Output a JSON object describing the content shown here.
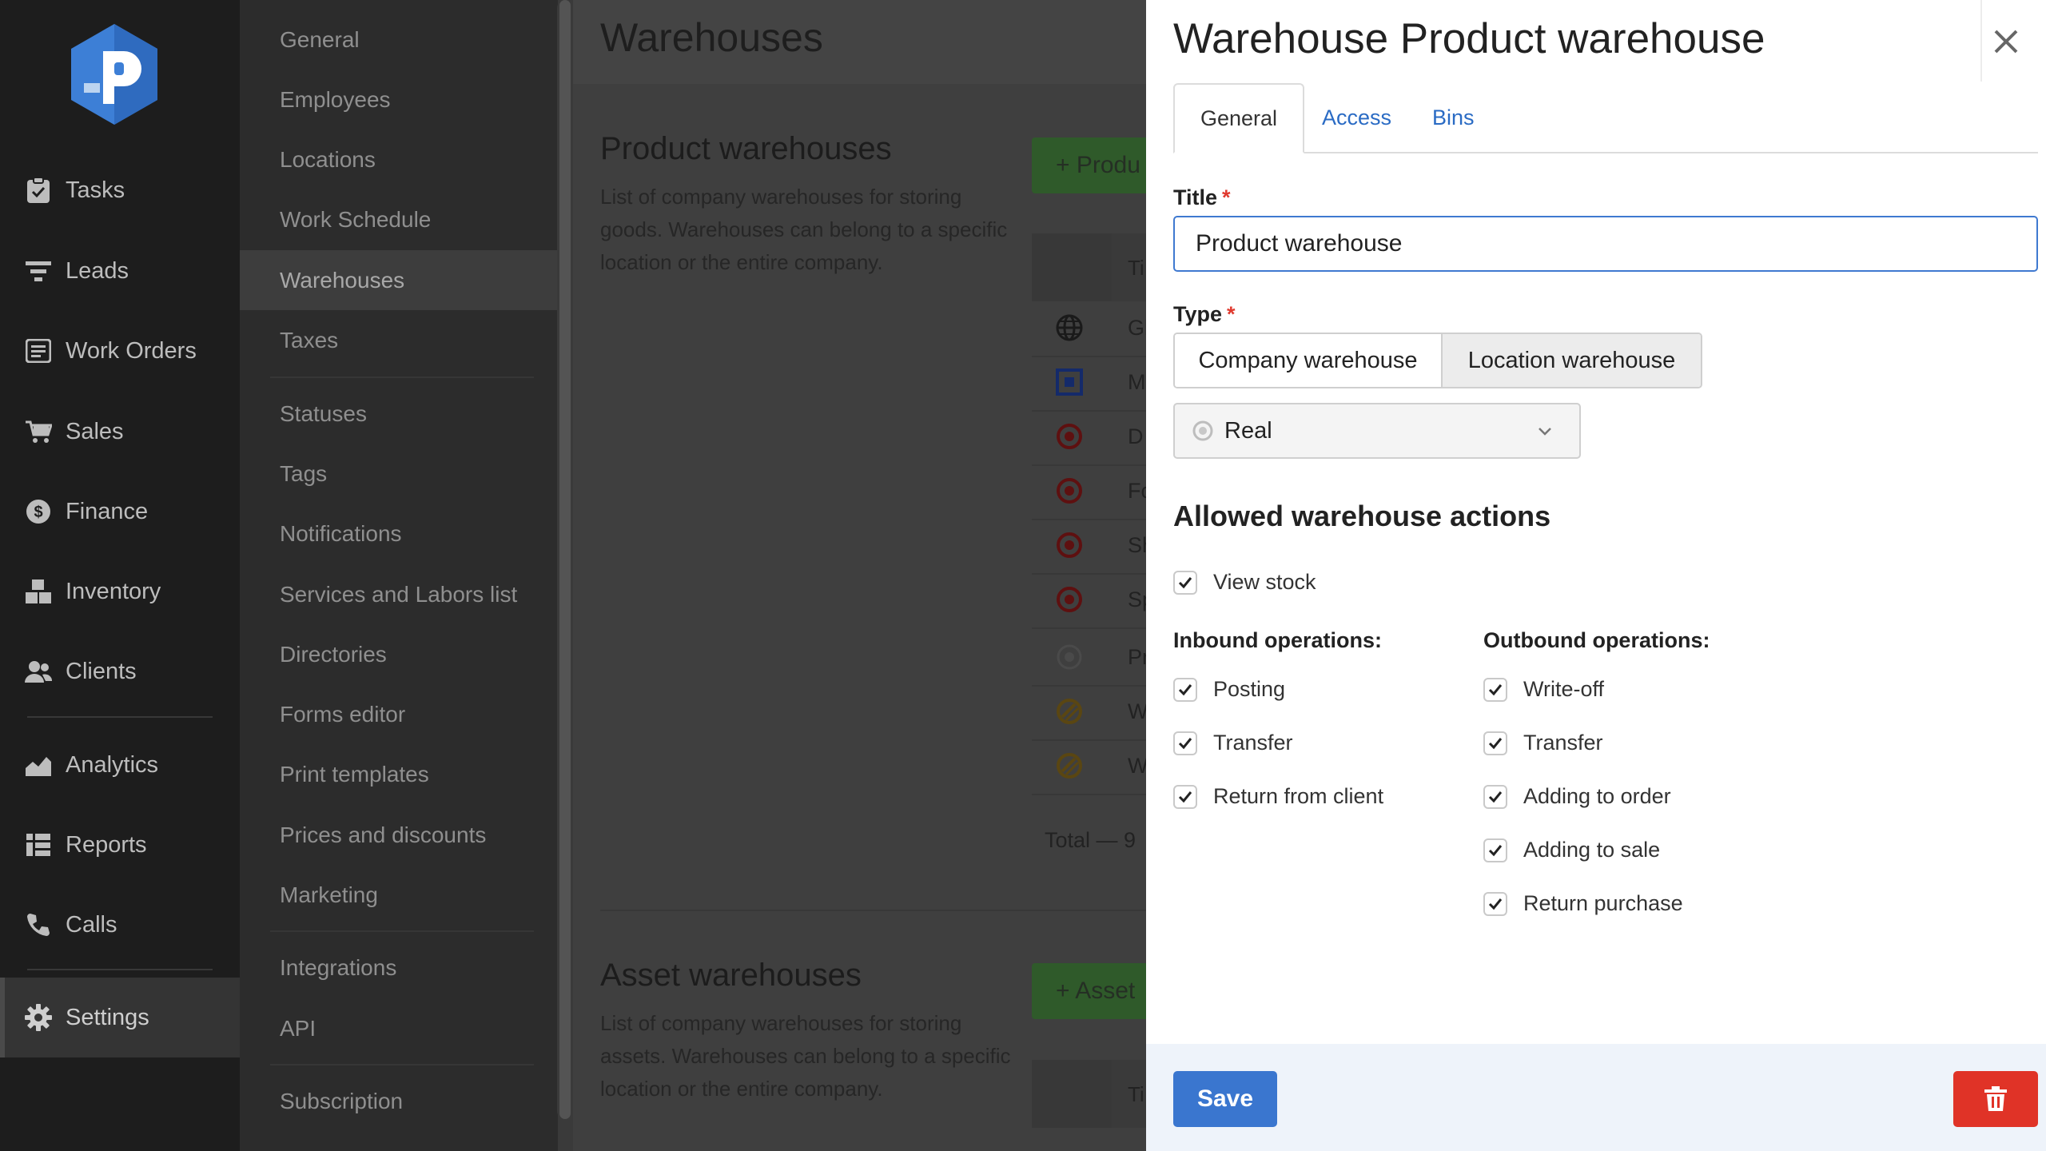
{
  "main_nav": {
    "items": [
      {
        "label": "Tasks",
        "icon": "clipboard-check-icon"
      },
      {
        "label": "Leads",
        "icon": "filter-icon"
      },
      {
        "label": "Work Orders",
        "icon": "work-order-icon"
      },
      {
        "label": "Sales",
        "icon": "cart-icon"
      },
      {
        "label": "Finance",
        "icon": "dollar-icon"
      },
      {
        "label": "Inventory",
        "icon": "boxes-icon"
      },
      {
        "label": "Clients",
        "icon": "users-icon"
      },
      {
        "label": "Analytics",
        "icon": "chart-area-icon"
      },
      {
        "label": "Reports",
        "icon": "reports-icon"
      },
      {
        "label": "Calls",
        "icon": "phone-icon"
      },
      {
        "label": "Settings",
        "icon": "gear-icon",
        "active": true
      }
    ]
  },
  "settings_nav": {
    "items": [
      {
        "label": "General"
      },
      {
        "label": "Employees"
      },
      {
        "label": "Locations"
      },
      {
        "label": "Work Schedule"
      },
      {
        "label": "Warehouses",
        "active": true
      },
      {
        "label": "Taxes"
      },
      {
        "label": "Statuses"
      },
      {
        "label": "Tags"
      },
      {
        "label": "Notifications"
      },
      {
        "label": "Services and Labors list"
      },
      {
        "label": "Directories"
      },
      {
        "label": "Forms editor"
      },
      {
        "label": "Print templates"
      },
      {
        "label": "Prices and discounts"
      },
      {
        "label": "Marketing"
      },
      {
        "label": "Integrations"
      },
      {
        "label": "API"
      },
      {
        "label": "Subscription"
      }
    ]
  },
  "content": {
    "title": "Warehouses",
    "product_section": {
      "title": "Product warehouses",
      "description": "List of company warehouses for storing goods. Warehouses can belong to a specific location or the entire company.",
      "add_button": "+ Produ",
      "table_header": "Ti",
      "rows": [
        {
          "text": "Gl",
          "icon": "globe-icon",
          "color": "#1a1a1a"
        },
        {
          "text": "M",
          "icon": "square-icon",
          "color": "#142a6a"
        },
        {
          "text": "D",
          "icon": "target-icon",
          "color": "#5e1010"
        },
        {
          "text": "Fo",
          "icon": "target-icon",
          "color": "#5e1010"
        },
        {
          "text": "Sh",
          "icon": "target-icon",
          "color": "#5e1010"
        },
        {
          "text": "Sp",
          "icon": "target-icon",
          "color": "#5e1010"
        },
        {
          "text": "Pr",
          "icon": "circle-dot-icon",
          "color": "#4a4a4a"
        },
        {
          "text": "W",
          "icon": "hatched-circle-icon",
          "color": "#5a4612"
        },
        {
          "text": "W",
          "icon": "hatched-circle-icon",
          "color": "#5a4612"
        }
      ],
      "total": "Total — 9"
    },
    "asset_section": {
      "title": "Asset warehouses",
      "description": "List of company warehouses for storing assets. Warehouses can belong to a specific location or the entire company.",
      "add_button": "+ Asset",
      "table_header": "Ti"
    }
  },
  "modal": {
    "title": "Warehouse Product warehouse",
    "tabs": [
      {
        "label": "General",
        "active": true
      },
      {
        "label": "Access"
      },
      {
        "label": "Bins"
      }
    ],
    "title_label": "Title",
    "title_value": "Product warehouse",
    "required_mark": "*",
    "type_label": "Type",
    "type_options": [
      "Company warehouse",
      "Location warehouse"
    ],
    "type_selected": "Location warehouse",
    "kind_select": "Real",
    "actions_title": "Allowed warehouse actions",
    "view_stock": {
      "label": "View stock",
      "checked": true
    },
    "inbound_title": "Inbound operations:",
    "inbound": [
      {
        "label": "Posting",
        "checked": true
      },
      {
        "label": "Transfer",
        "checked": true
      },
      {
        "label": "Return from client",
        "checked": true
      }
    ],
    "outbound_title": "Outbound operations:",
    "outbound": [
      {
        "label": "Write-off",
        "checked": true
      },
      {
        "label": "Transfer",
        "checked": true
      },
      {
        "label": "Adding to order",
        "checked": true
      },
      {
        "label": "Adding to sale",
        "checked": true
      },
      {
        "label": "Return purchase",
        "checked": true
      }
    ],
    "save_label": "Save"
  },
  "colors": {
    "accent": "#3a76cf",
    "danger": "#e03327",
    "logo": "#3d7fd6"
  }
}
